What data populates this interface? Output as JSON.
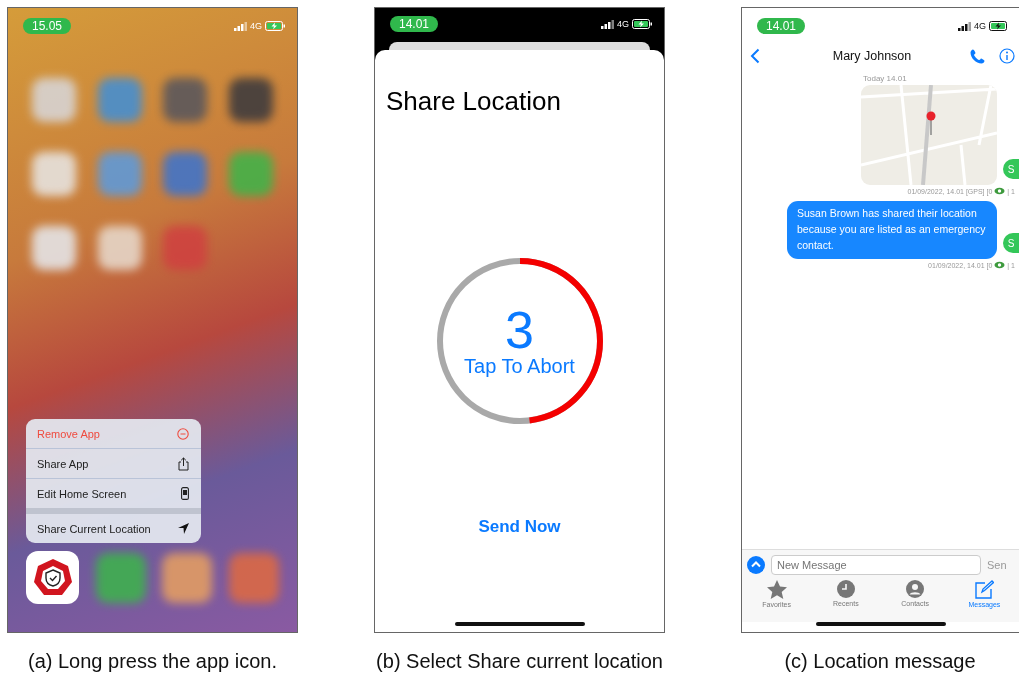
{
  "home_screen": {
    "status_bar": {
      "time": "15.05",
      "network": "4G"
    },
    "context_menu": [
      {
        "label": "Remove App",
        "kind": "remove",
        "separated": false
      },
      {
        "label": "Share App",
        "kind": "share",
        "separated": false
      },
      {
        "label": "Edit Home Screen",
        "kind": "edit",
        "separated": false
      },
      {
        "label": "Share Current Location",
        "kind": "location",
        "separated": true
      }
    ],
    "caption": "(a) Long press the app icon."
  },
  "share_screen": {
    "status_bar": {
      "time": "14.01",
      "network": "4G"
    },
    "title": "Share Location",
    "countdown": {
      "number": "3",
      "label": "Tap To Abort",
      "level": 0.48
    },
    "send_button": "Send Now",
    "caption": "(b) Select Share current location"
  },
  "messages_screen": {
    "status_bar": {
      "time": "14.01",
      "network": "4G"
    },
    "contact_name": "Mary Johnson",
    "date_header": "Today 14.01",
    "messages": [
      {
        "kind": "map",
        "meta": "01/09/2022, 14.01 [GPS] [0",
        "meta_count": "| 1",
        "avatar": "S"
      },
      {
        "kind": "text",
        "text": "Susan Brown has shared their location because you are listed as an emergency contact.",
        "meta": "01/09/2022, 14.01  [0",
        "meta_count": "| 1",
        "avatar": "S"
      }
    ],
    "composer": {
      "placeholder": "New Message",
      "send": "Sen"
    },
    "tabs": [
      {
        "label": "Favorites",
        "kind": "star",
        "selected": false
      },
      {
        "label": "Recents",
        "kind": "clock",
        "selected": false
      },
      {
        "label": "Contacts",
        "kind": "person",
        "selected": false
      },
      {
        "label": "Messages",
        "kind": "compose",
        "selected": true
      }
    ],
    "caption": "(c) Location message"
  }
}
